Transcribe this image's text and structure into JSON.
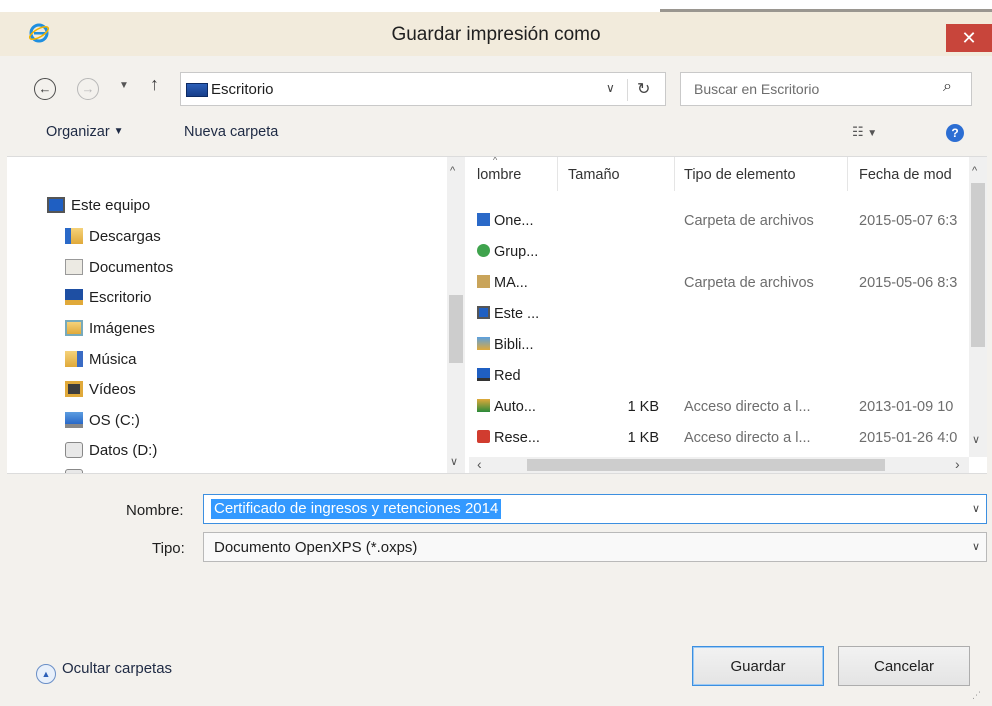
{
  "window": {
    "title": "Guardar impresión como",
    "close_glyph": "✕",
    "app_icon": "internet-explorer-icon"
  },
  "address": {
    "location": "Escritorio",
    "search_placeholder": "Buscar en Escritorio"
  },
  "toolbar": {
    "organize_label": "Organizar",
    "new_folder_label": "Nueva carpeta"
  },
  "nav_tree": {
    "items": [
      {
        "label": "Este equipo",
        "icon": "computer-icon"
      },
      {
        "label": "Descargas",
        "icon": "downloads-folder-icon"
      },
      {
        "label": "Documentos",
        "icon": "documents-folder-icon"
      },
      {
        "label": "Escritorio",
        "icon": "desktop-folder-icon"
      },
      {
        "label": "Imágenes",
        "icon": "pictures-folder-icon"
      },
      {
        "label": "Música",
        "icon": "music-folder-icon"
      },
      {
        "label": "Vídeos",
        "icon": "videos-folder-icon"
      },
      {
        "label": "OS (C:)",
        "icon": "os-drive-icon"
      },
      {
        "label": "Datos (D:)",
        "icon": "drive-icon"
      }
    ]
  },
  "file_list": {
    "columns": [
      "lombre",
      "Tamaño",
      "Tipo de elemento",
      "Fecha de mod"
    ],
    "rows": [
      {
        "name": "One...",
        "size": "",
        "type": "Carpeta de archivos",
        "date": "2015-05-07 6:3",
        "icon": "onedrive-folder-icon"
      },
      {
        "name": "Grup...",
        "size": "",
        "type": "",
        "date": "",
        "icon": "homegroup-icon"
      },
      {
        "name": "MA...",
        "size": "",
        "type": "Carpeta de archivos",
        "date": "2015-05-06 8:3",
        "icon": "user-folder-icon"
      },
      {
        "name": "Este ...",
        "size": "",
        "type": "",
        "date": "",
        "icon": "computer-icon"
      },
      {
        "name": "Bibli...",
        "size": "",
        "type": "",
        "date": "",
        "icon": "libraries-icon"
      },
      {
        "name": "Red",
        "size": "",
        "type": "",
        "date": "",
        "icon": "network-icon"
      },
      {
        "name": "Auto...",
        "size": "1 KB",
        "type": "Acceso directo a l...",
        "date": "2013-01-09 10",
        "icon": "shortcut-icon"
      },
      {
        "name": "Rese...",
        "size": "1 KB",
        "type": "Acceso directo a l...",
        "date": "2015-01-26 4:0",
        "icon": "shortcut-red-icon"
      }
    ]
  },
  "form": {
    "name_label": "Nombre:",
    "name_value": "Certificado de ingresos y retenciones 2014",
    "type_label": "Tipo:",
    "type_value": "Documento OpenXPS (*.oxps)"
  },
  "footer": {
    "hide_folders_label": "Ocultar carpetas",
    "save_label": "Guardar",
    "cancel_label": "Cancelar"
  },
  "colors": {
    "close": "#c8453b",
    "selection": "#3399ff",
    "focus_border": "#3c8fe0"
  }
}
